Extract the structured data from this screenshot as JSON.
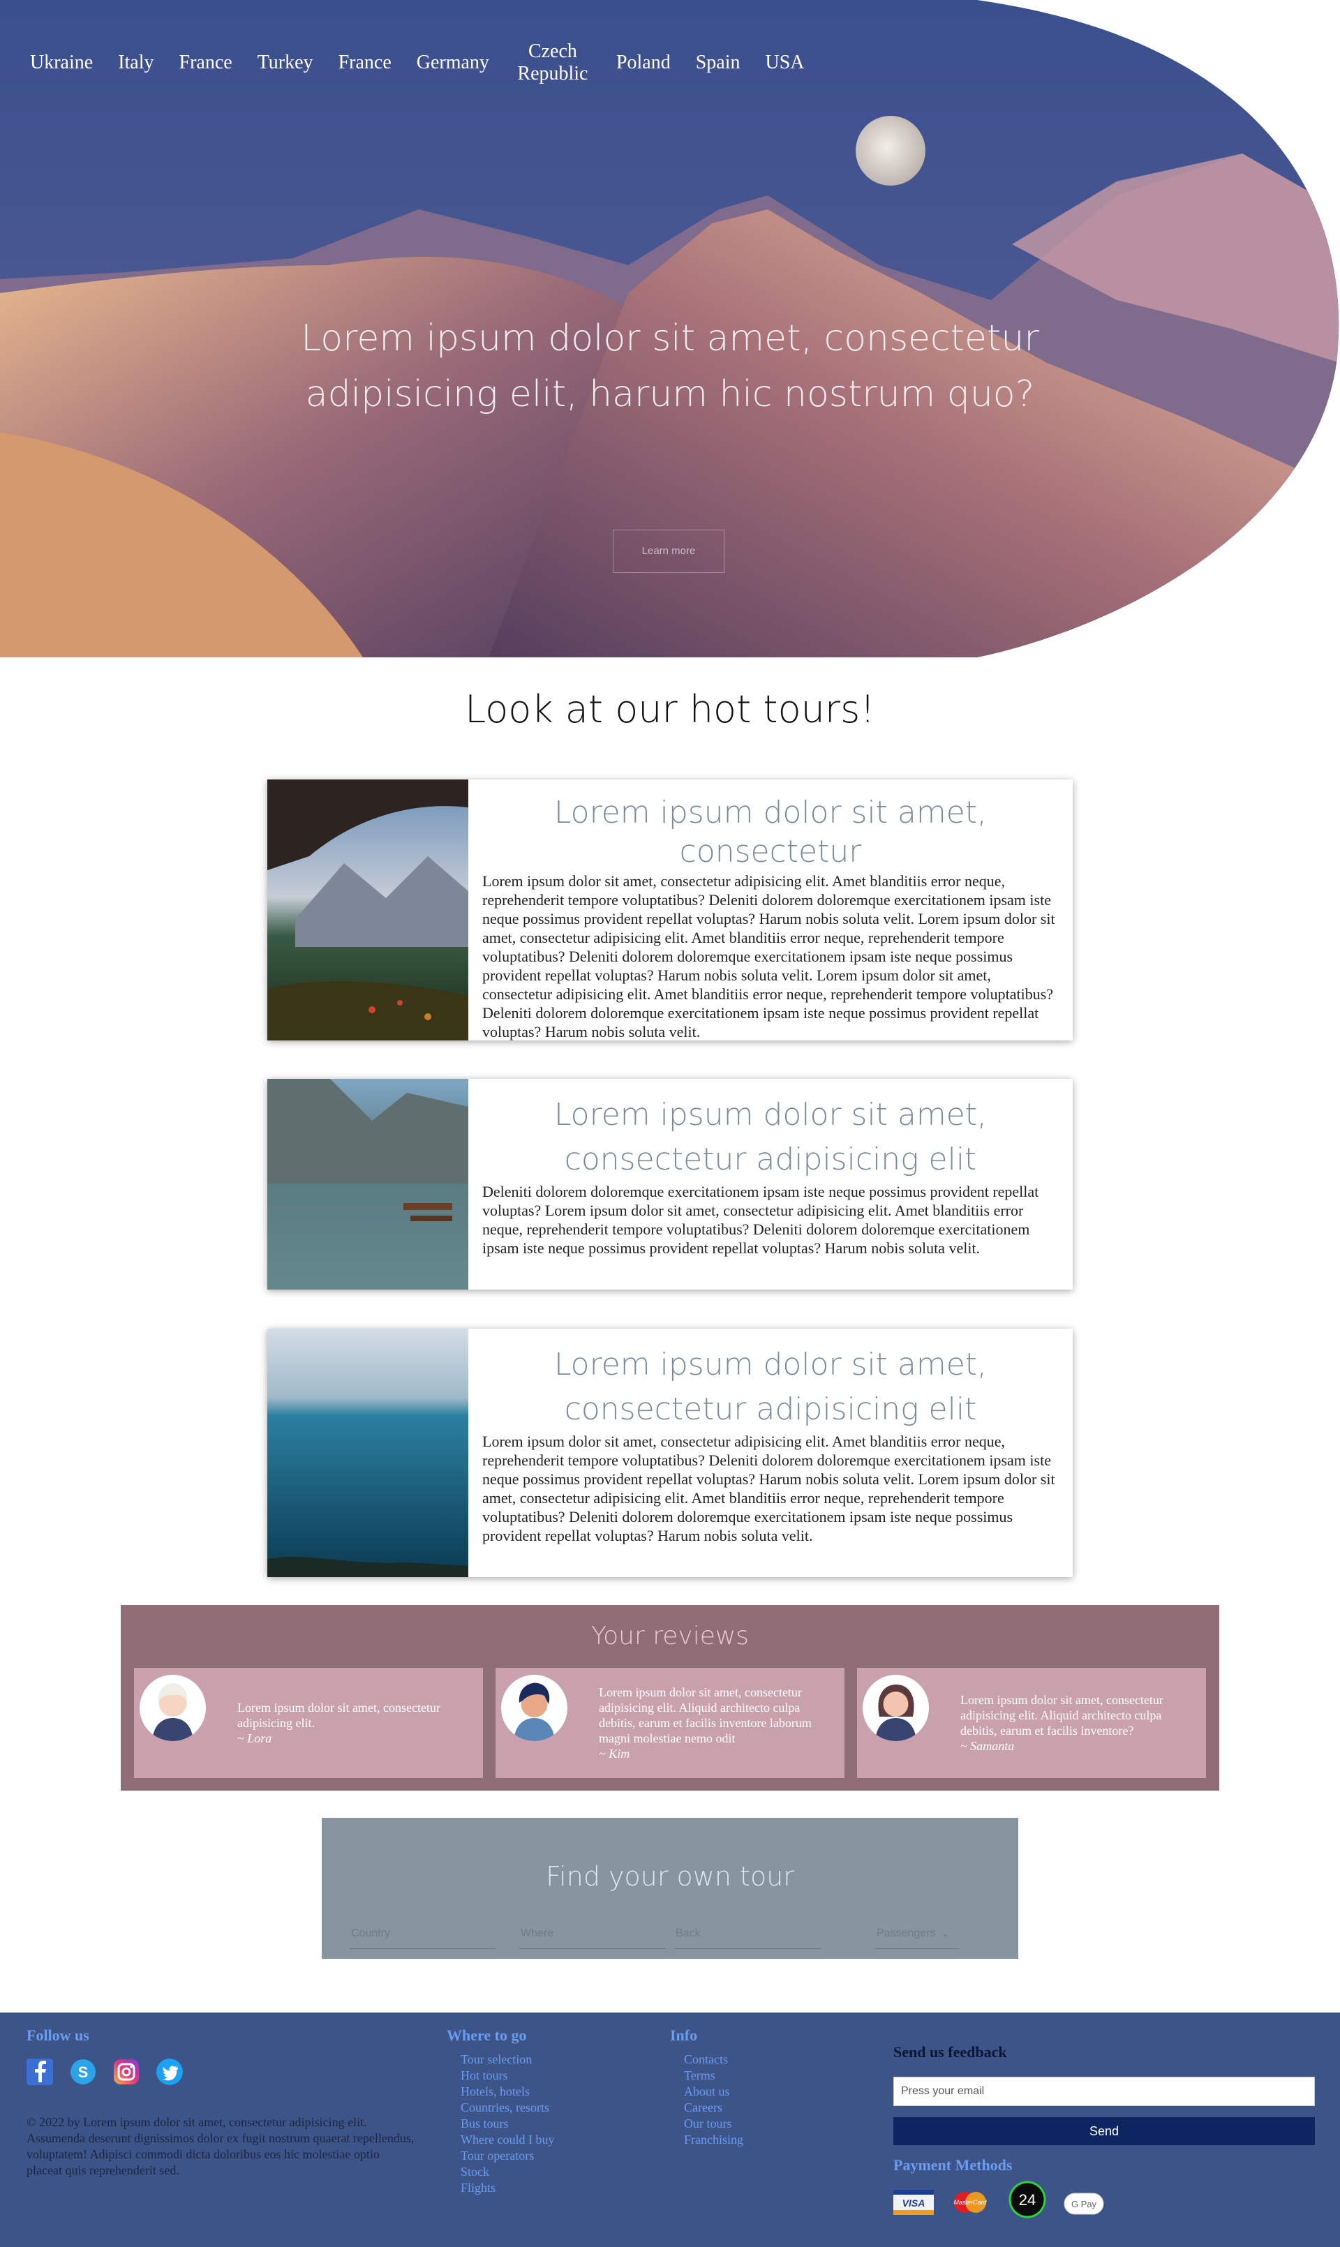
{
  "nav": {
    "items": [
      "Ukraine",
      "Italy",
      "France",
      "Turkey",
      "France",
      "Germany",
      "Czech Republic",
      "Poland",
      "Spain",
      "USA"
    ]
  },
  "hero": {
    "title": "Lorem ipsum dolor sit amet, consectetur adipisicing elit, harum hic nostrum quo?",
    "button": "Learn more"
  },
  "hot_tours": {
    "title": "Look at our hot tours!",
    "tours": [
      {
        "title": "Lorem ipsum dolor sit amet, consectetur",
        "text": "Lorem ipsum dolor sit amet, consectetur adipisicing elit. Amet blanditiis error neque, reprehenderit tempore voluptatibus? Deleniti dolorem doloremque exercitationem ipsam iste neque possimus provident repellat voluptas? Harum nobis soluta velit. Lorem ipsum dolor sit amet, consectetur adipisicing elit. Amet blanditiis error neque, reprehenderit tempore voluptatibus? Deleniti dolorem doloremque exercitationem ipsam iste neque possimus provident repellat voluptas? Harum nobis soluta velit. Lorem ipsum dolor sit amet, consectetur adipisicing elit. Amet blanditiis error neque, reprehenderit tempore voluptatibus? Deleniti dolorem doloremque exercitationem ipsam iste neque possimus provident repellat voluptas? Harum nobis soluta velit."
      },
      {
        "title": "Lorem ipsum dolor sit amet, consectetur adipisicing elit",
        "text": "Deleniti dolorem doloremque exercitationem ipsam iste neque possimus provident repellat voluptas? Lorem ipsum dolor sit amet, consectetur adipisicing elit. Amet blanditiis error neque, reprehenderit tempore voluptatibus? Deleniti dolorem doloremque exercitationem ipsam iste neque possimus provident repellat voluptas? Harum nobis soluta velit."
      },
      {
        "title": "Lorem ipsum dolor sit amet, consectetur adipisicing elit",
        "text": "Lorem ipsum dolor sit amet, consectetur adipisicing elit. Amet blanditiis error neque, reprehenderit tempore voluptatibus? Deleniti dolorem doloremque exercitationem ipsam iste neque possimus provident repellat voluptas? Harum nobis soluta velit. Lorem ipsum dolor sit amet, consectetur adipisicing elit. Amet blanditiis error neque, reprehenderit tempore voluptatibus? Deleniti dolorem doloremque exercitationem ipsam iste neque possimus provident repellat voluptas? Harum nobis soluta velit."
      }
    ]
  },
  "reviews": {
    "title": "Your reviews",
    "items": [
      {
        "text": "Lorem ipsum dolor sit amet, consectetur adipisicing elit.",
        "author": "~ Lora"
      },
      {
        "text": "Lorem ipsum dolor sit amet, consectetur adipisicing elit. Aliquid architecto culpa debitis, earum et facilis inventore laborum magni molestiae nemo odit",
        "author": "~ Kim"
      },
      {
        "text": "Lorem ipsum dolor sit amet, consectetur adipisicing elit. Aliquid architecto culpa debitis, earum et facilis inventore?",
        "author": "~ Samanta"
      }
    ]
  },
  "find": {
    "title": "Find your own tour",
    "fields": {
      "country": "Country",
      "where": "Where",
      "back": "Back",
      "passengers": "Passengers"
    }
  },
  "footer": {
    "follow_title": "Follow us",
    "copyright": "© 2022 by Lorem ipsum dolor sit amet, consectetur adipisicing elit. Assumenda deserunt dignissimos dolor ex fugit nostrum quaerat repellendus, voluptatem! Adipisci commodi dicta doloribus eos hic molestiae optio placeat quis reprehenderit sed.",
    "where_title": "Where to go",
    "where_links": [
      "Tour selection",
      "Hot tours",
      "Hotels, hotels",
      "Countries, resorts",
      "Bus tours",
      "Where could I buy",
      "Tour operators",
      "Stock",
      "Flights"
    ],
    "info_title": "Info",
    "info_links": [
      "Contacts",
      "Terms",
      "About us",
      "Careers",
      "Our tours",
      "Franchising"
    ],
    "feedback_title": "Send us feedback",
    "email_placeholder": "Press your email",
    "send_label": "Send",
    "payment_title": "Payment Methods",
    "payment_24": "24",
    "gpay_label": "G Pay"
  },
  "colors": {
    "footer_bg": "#3d5489",
    "reviews_bg": "#8e6d76",
    "review_card": "#c9a1ad",
    "find_bg": "#8795a1",
    "send_bg": "#0d2561",
    "link": "#6a9cef"
  }
}
